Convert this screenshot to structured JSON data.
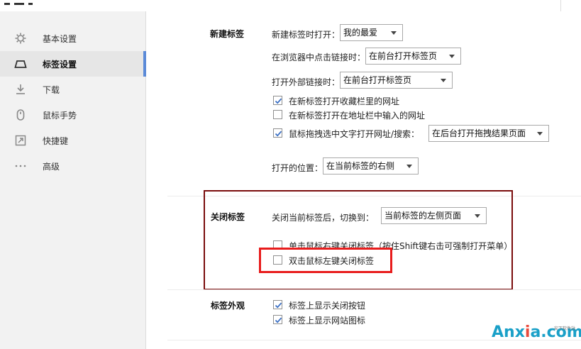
{
  "sidebar": {
    "items": [
      {
        "label": "基本设置",
        "icon": "gear-icon"
      },
      {
        "label": "标签设置",
        "icon": "tab-icon",
        "active": true
      },
      {
        "label": "下载",
        "icon": "download-icon"
      },
      {
        "label": "鼠标手势",
        "icon": "mouse-icon"
      },
      {
        "label": "快捷键",
        "icon": "shortcut-icon"
      },
      {
        "label": "高级",
        "icon": "more-dots-icon"
      }
    ]
  },
  "new_tab": {
    "title": "新建标签",
    "open_new_label": "新建标签时打开：",
    "open_new_value": "我的最爱",
    "click_link_label": "在浏览器中点击链接时：",
    "click_link_value": "在前台打开标签页",
    "external_link_label": "打开外部链接时：",
    "external_link_value": "在前台打开标签页",
    "checkboxes": [
      {
        "label": "在新标签打开收藏栏里的网址",
        "checked": true
      },
      {
        "label": "在新标签打开在地址栏中输入的网址",
        "checked": false
      },
      {
        "label": "鼠标拖拽选中文字打开网址/搜索：",
        "checked": true
      }
    ],
    "drag_value": "在后台打开拖拽结果页面",
    "position_label": "打开的位置：",
    "position_value": "在当前标签的右侧"
  },
  "close_tab": {
    "title": "关闭标签",
    "after_close_label": "关闭当前标签后，切换到：",
    "after_close_value": "当前标签的左侧页面",
    "checkboxes": [
      {
        "label": "单击鼠标右键关闭标签（按住Shift键右击可强制打开菜单）",
        "checked": false
      },
      {
        "label": "双击鼠标左键关闭标签",
        "checked": false
      }
    ]
  },
  "tab_look": {
    "title": "标签外观",
    "checkboxes": [
      {
        "label": "标签上显示关闭按钮",
        "checked": true
      },
      {
        "label": "标签上显示网站图标",
        "checked": true
      }
    ]
  },
  "colors": {
    "highlight_dark": "#7a0c0c",
    "highlight_red": "#e81c1c",
    "active_bar": "#5b8ad8"
  },
  "watermark": {
    "text_a": "Anx",
    "text_x": "i",
    "text_b": "a.com",
    "small": "安下软件站"
  }
}
